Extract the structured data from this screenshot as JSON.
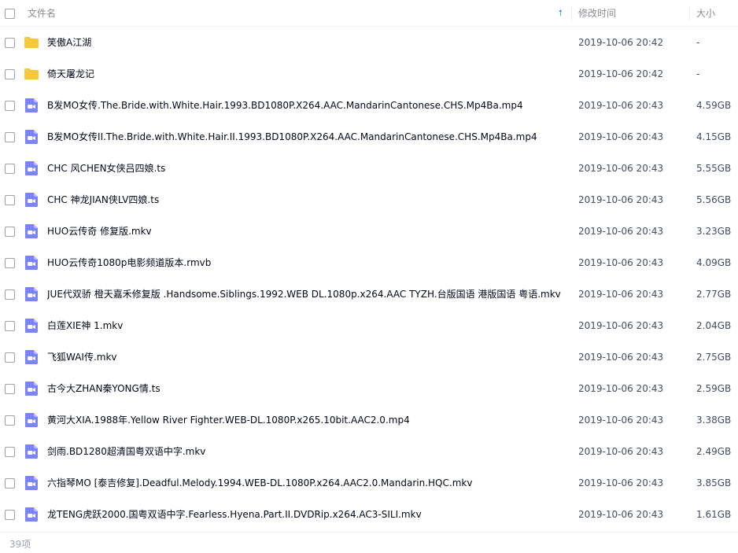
{
  "header": {
    "name_label": "文件名",
    "time_label": "修改时间",
    "size_label": "大小",
    "sort_icon": "sort-up-arrow-icon"
  },
  "colors": {
    "folder": "#f7c73e",
    "video": "#7c81ff",
    "accent": "#3b8cff"
  },
  "files": [
    {
      "name": "笑傲A江湖",
      "type": "folder",
      "time": "2019-10-06 20:42",
      "size": "-"
    },
    {
      "name": "倚天屠龙记",
      "type": "folder",
      "time": "2019-10-06 20:42",
      "size": "-"
    },
    {
      "name": "B发MO女传.The.Bride.with.White.Hair.1993.BD1080P.X264.AAC.MandarinCantonese.CHS.Mp4Ba.mp4",
      "type": "video",
      "time": "2019-10-06 20:43",
      "size": "4.59GB"
    },
    {
      "name": "B发MO女传II.The.Bride.with.White.Hair.II.1993.BD1080P.X264.AAC.MandarinCantonese.CHS.Mp4Ba.mp4",
      "type": "video",
      "time": "2019-10-06 20:43",
      "size": "4.15GB"
    },
    {
      "name": "CHC 风CHEN女侠吕四娘.ts",
      "type": "video",
      "time": "2019-10-06 20:43",
      "size": "5.55GB"
    },
    {
      "name": "CHC 神龙JIAN侠LV四娘.ts",
      "type": "video",
      "time": "2019-10-06 20:43",
      "size": "5.56GB"
    },
    {
      "name": "HUO云传奇 修复版.mkv",
      "type": "video",
      "time": "2019-10-06 20:43",
      "size": "3.23GB"
    },
    {
      "name": "HUO云传奇1080p电影频道版本.rmvb",
      "type": "video",
      "time": "2019-10-06 20:43",
      "size": "4.09GB"
    },
    {
      "name": "JUE代双骄 橙天嘉禾修复版 .Handsome.Siblings.1992.WEB DL.1080p.x264.AAC TYZH.台版国语 港版国语 粤语.mkv",
      "type": "video",
      "time": "2019-10-06 20:43",
      "size": "2.77GB"
    },
    {
      "name": "白莲XIE神 1.mkv",
      "type": "video",
      "time": "2019-10-06 20:43",
      "size": "2.04GB"
    },
    {
      "name": "飞狐WAI传.mkv",
      "type": "video",
      "time": "2019-10-06 20:43",
      "size": "2.75GB"
    },
    {
      "name": "古今大ZHAN秦YONG情.ts",
      "type": "video",
      "time": "2019-10-06 20:43",
      "size": "2.59GB"
    },
    {
      "name": "黄河大XIA.1988年.Yellow River Fighter.WEB-DL.1080P.x265.10bit.AAC2.0.mp4",
      "type": "video",
      "time": "2019-10-06 20:43",
      "size": "3.38GB"
    },
    {
      "name": "剑雨.BD1280超清国粤双语中字.mkv",
      "type": "video",
      "time": "2019-10-06 20:43",
      "size": "2.49GB"
    },
    {
      "name": "六指琴MO [泰吉修复].Deadful.Melody.1994.WEB-DL.1080P.x264.AAC2.0.Mandarin.HQC.mkv",
      "type": "video",
      "time": "2019-10-06 20:43",
      "size": "3.85GB"
    },
    {
      "name": "龙TENG虎跃2000.国粤双语中字.Fearless.Hyena.Part.II.DVDRip.x264.AC3-SILI.mkv",
      "type": "video",
      "time": "2019-10-06 20:43",
      "size": "1.61GB"
    }
  ],
  "footer": {
    "count": "39项"
  }
}
